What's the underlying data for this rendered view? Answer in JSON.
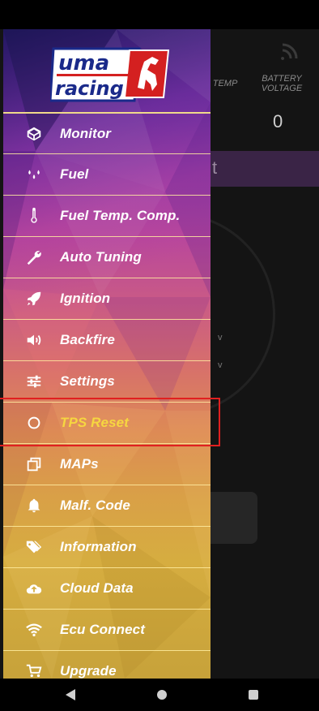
{
  "background": {
    "header_temp_label": "TEMP",
    "header_battery_label": "BATTERY VOLTAGE",
    "battery_value": "0",
    "band_letter": "t"
  },
  "brand": {
    "line1": "uma",
    "line2": "racing"
  },
  "menu": {
    "items": [
      {
        "label": "Monitor",
        "icon": "monitor-icon"
      },
      {
        "label": "Fuel",
        "icon": "fuel-drops-icon"
      },
      {
        "label": "Fuel Temp. Comp.",
        "icon": "thermometer-icon"
      },
      {
        "label": "Auto Tuning",
        "icon": "wrench-icon"
      },
      {
        "label": "Ignition",
        "icon": "rocket-icon"
      },
      {
        "label": "Backfire",
        "icon": "speaker-icon"
      },
      {
        "label": "Settings",
        "icon": "sliders-icon"
      },
      {
        "label": "TPS Reset",
        "icon": "circle-icon",
        "active": true
      },
      {
        "label": "MAPs",
        "icon": "copy-icon"
      },
      {
        "label": "Malf. Code",
        "icon": "bell-icon"
      },
      {
        "label": "Information",
        "icon": "tags-icon"
      },
      {
        "label": "Cloud Data",
        "icon": "cloud-upload-icon"
      },
      {
        "label": "Ecu Connect",
        "icon": "wifi-icon"
      },
      {
        "label": "Upgrade",
        "icon": "cart-icon"
      }
    ]
  },
  "colors": {
    "active_label": "#f6d640",
    "highlight_box": "#e02020"
  }
}
